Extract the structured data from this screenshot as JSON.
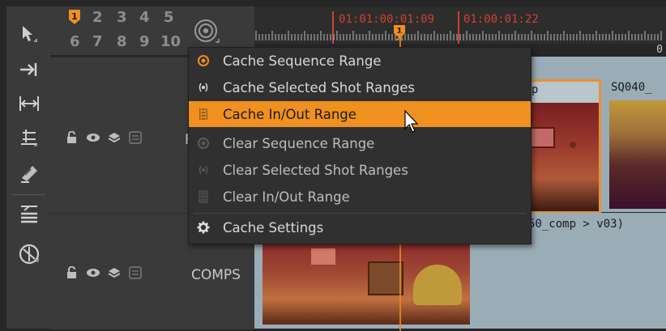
{
  "header": {
    "track_numbers_row1": [
      "2",
      "3",
      "4",
      "5"
    ],
    "track_numbers_row2": [
      "6",
      "7",
      "8",
      "9",
      "10"
    ],
    "marker_label": "1",
    "playhead_marker_label": "1"
  },
  "ruler": {
    "timecode_overlap": "01:01:00:01:09",
    "timecode_out": "01:00:01:22",
    "zero_label": "0"
  },
  "menu": {
    "items": [
      {
        "label": "Cache Sequence Range",
        "icon": "target-icon",
        "state": "normal"
      },
      {
        "label": "Cache Selected Shot Ranges",
        "icon": "dot-brackets-icon",
        "state": "normal"
      },
      {
        "label": "Cache In/Out Range",
        "icon": "film-bracket-icon",
        "state": "highlighted"
      },
      {
        "label": "Clear Sequence Range",
        "icon": "target-icon",
        "state": "dim"
      },
      {
        "label": "Clear Selected Shot Ranges",
        "icon": "dot-brackets-icon",
        "state": "dim"
      },
      {
        "label": "Clear In/Out Range",
        "icon": "film-bracket-icon",
        "state": "dim"
      },
      {
        "label": "Cache Settings",
        "icon": "gear-icon",
        "state": "normal"
      }
    ]
  },
  "tracks": {
    "top_track_name": "F",
    "bottom_track_name": "COMPS",
    "clip1_label": "omp",
    "clip2_label": "SQ040_",
    "clip3_label": "50_comp > v03)"
  },
  "colors": {
    "accent_orange": "#f0901e",
    "timecode_red": "#d0412e",
    "panel_dark": "#3a3a3a",
    "menu_bg": "#303030"
  }
}
